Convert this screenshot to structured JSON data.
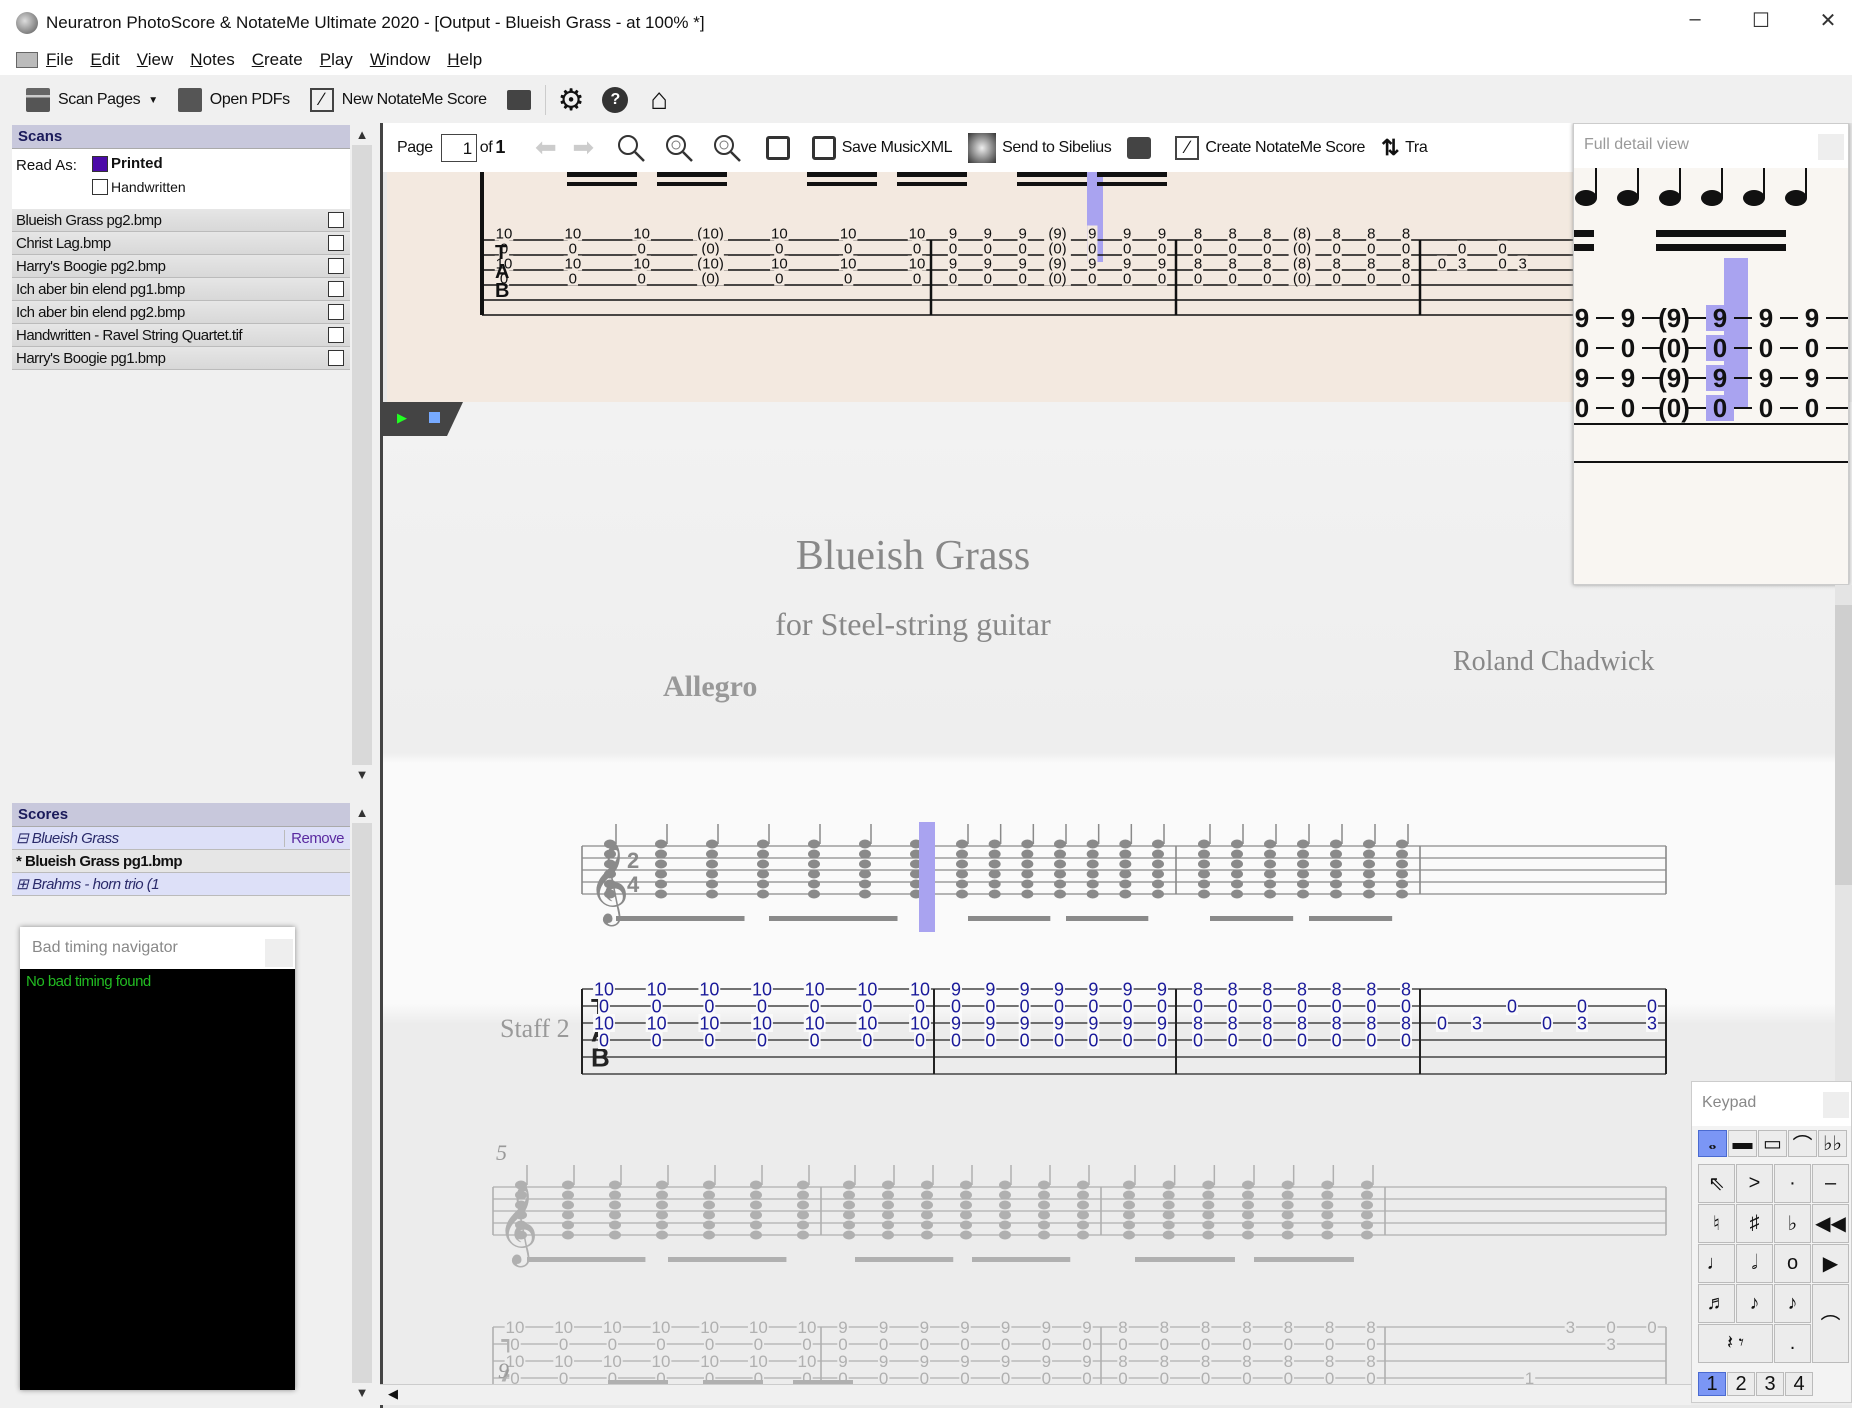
{
  "window": {
    "title": "Neuratron PhotoScore & NotateMe Ultimate 2020 - [Output - Blueish Grass - at 100% *]",
    "minimize": "–",
    "maximize": "☐",
    "close": "✕"
  },
  "menu": [
    "File",
    "Edit",
    "View",
    "Notes",
    "Create",
    "Play",
    "Window",
    "Help"
  ],
  "toolbar": {
    "scan_pages": "Scan Pages",
    "open_pdfs": "Open PDFs",
    "new_notateme": "New NotateMe Score"
  },
  "scans": {
    "header": "Scans",
    "read_as": "Read As:",
    "printed": "Printed",
    "handwritten": "Handwritten",
    "printed_checked": true,
    "files": [
      "Blueish Grass pg2.bmp",
      "Christ Lag.bmp",
      "Harry's Boogie pg2.bmp",
      "Ich aber bin elend pg1.bmp",
      "Ich aber bin elend pg2.bmp",
      "Handwritten - Ravel String Quartet.tif",
      "Harry's Boogie pg1.bmp"
    ]
  },
  "scores": {
    "header": "Scores",
    "items": [
      {
        "label": "Blueish Grass",
        "toggle": "⊟",
        "action": "Remove"
      },
      {
        "label": "* Blueish Grass pg1.bmp"
      },
      {
        "label": "Brahms - horn trio (1",
        "toggle": "⊞"
      }
    ]
  },
  "navigator": {
    "title": "Bad timing navigator",
    "message": "No bad timing found",
    "message_color": "#22bb22"
  },
  "doc_toolbar": {
    "page_label": "Page",
    "page_value": "1",
    "of_label": "of",
    "page_total": "1",
    "save_musicxml": "Save MusicXML",
    "send_sibelius": "Send to Sibelius",
    "create_notateme": "Create NotateMe Score",
    "transpose": "Tra"
  },
  "detail_view": {
    "title": "Full detail view",
    "tab_rows": [
      [
        "9",
        "9",
        "(9)",
        "9",
        "9",
        "9"
      ],
      [
        "0",
        "0",
        "(0)",
        "0",
        "0",
        "0"
      ],
      [
        "9",
        "9",
        "(9)",
        "9",
        "9",
        "9"
      ],
      [
        "0",
        "0",
        "(0)",
        "0",
        "0",
        "0"
      ]
    ]
  },
  "scan_tab": {
    "measures": [
      [
        [
          "10",
          "10",
          "10",
          "(10)",
          "10",
          "10",
          "10"
        ],
        [
          "0",
          "0",
          "0",
          "(0)",
          "0",
          "0",
          "0"
        ],
        [
          "10",
          "10",
          "10",
          "(10)",
          "10",
          "10",
          "10"
        ],
        [
          "0",
          "0",
          "0",
          "(0)",
          "0",
          "0",
          "0"
        ]
      ],
      [
        [
          "9",
          "9",
          "9",
          "(9)",
          "9",
          "9",
          "9"
        ],
        [
          "0",
          "0",
          "0",
          "(0)",
          "0",
          "0",
          "0"
        ],
        [
          "9",
          "9",
          "9",
          "(9)",
          "9",
          "9",
          "9"
        ],
        [
          "0",
          "0",
          "0",
          "(0)",
          "0",
          "0",
          "0"
        ]
      ],
      [
        [
          "8",
          "8",
          "8",
          "(8)",
          "8",
          "8",
          "8"
        ],
        [
          "0",
          "0",
          "0",
          "(0)",
          "0",
          "0",
          "0"
        ],
        [
          "8",
          "8",
          "8",
          "(8)",
          "8",
          "8",
          "8"
        ],
        [
          "0",
          "0",
          "0",
          "(0)",
          "0",
          "0",
          "0"
        ]
      ],
      [
        [],
        [
          "",
          "0",
          "",
          "0"
        ],
        [
          "0",
          "3",
          "",
          "0",
          "3"
        ],
        []
      ]
    ]
  },
  "score": {
    "title": "Blueish Grass",
    "subtitle": "for Steel-string guitar",
    "composer": "Roland Chadwick",
    "tempo": "Allegro",
    "staff_label": "Staff 2",
    "time_sig": [
      "2",
      "4"
    ],
    "tab_letters": [
      "T",
      "A",
      "B"
    ],
    "measure_numbers": [
      "5",
      "9"
    ],
    "tab_color": "#1a1a9a",
    "highlight_color": "#a9a3f0",
    "system1": [
      [
        [
          "10",
          "10",
          "10",
          "10",
          "10",
          "10",
          "10"
        ],
        [
          "0",
          "0",
          "0",
          "0",
          "0",
          "0",
          "0"
        ],
        [
          "10",
          "10",
          "10",
          "10",
          "10",
          "10",
          "10"
        ],
        [
          "0",
          "0",
          "0",
          "0",
          "0",
          "0",
          "0"
        ]
      ],
      [
        [
          "9",
          "9",
          "9",
          "9",
          "9",
          "9",
          "9"
        ],
        [
          "0",
          "0",
          "0",
          "0",
          "0",
          "0",
          "0"
        ],
        [
          "9",
          "9",
          "9",
          "9",
          "9",
          "9",
          "9"
        ],
        [
          "0",
          "0",
          "0",
          "0",
          "0",
          "0",
          "0"
        ]
      ],
      [
        [
          "8",
          "8",
          "8",
          "8",
          "8",
          "8",
          "8"
        ],
        [
          "0",
          "0",
          "0",
          "0",
          "0",
          "0",
          "0"
        ],
        [
          "8",
          "8",
          "8",
          "8",
          "8",
          "8",
          "8"
        ],
        [
          "0",
          "0",
          "0",
          "0",
          "0",
          "0",
          "0"
        ]
      ],
      [
        [],
        [
          "",
          "",
          "0",
          "",
          "0",
          "",
          "0"
        ],
        [
          "0",
          "3",
          "",
          "0",
          "3",
          "",
          "3"
        ],
        []
      ]
    ],
    "system2": [
      [
        [
          "10",
          "10",
          "10",
          "10",
          "10",
          "10",
          "10"
        ],
        [
          "0",
          "0",
          "0",
          "0",
          "0",
          "0",
          "0"
        ],
        [
          "10",
          "10",
          "10",
          "10",
          "10",
          "10",
          "10"
        ],
        [
          "0",
          "0",
          "0",
          "0",
          "0",
          "0",
          "0"
        ]
      ],
      [
        [
          "9",
          "9",
          "9",
          "9",
          "9",
          "9",
          "9"
        ],
        [
          "0",
          "0",
          "0",
          "0",
          "0",
          "0",
          "0"
        ],
        [
          "9",
          "9",
          "9",
          "9",
          "9",
          "9",
          "9"
        ],
        [
          "0",
          "0",
          "0",
          "0",
          "0",
          "0",
          "0"
        ]
      ],
      [
        [
          "8",
          "8",
          "8",
          "8",
          "8",
          "8",
          "8"
        ],
        [
          "0",
          "0",
          "0",
          "0",
          "0",
          "0",
          "0"
        ],
        [
          "8",
          "8",
          "8",
          "8",
          "8",
          "8",
          "8"
        ],
        [
          "0",
          "0",
          "0",
          "0",
          "0",
          "0",
          "0"
        ]
      ],
      [
        [
          "",
          "",
          "",
          "",
          "3",
          "0",
          "0"
        ],
        [
          "",
          "",
          "",
          "",
          "",
          "3",
          ""
        ],
        [],
        [
          "",
          "",
          "",
          "1",
          "",
          "",
          ""
        ]
      ]
    ]
  },
  "keypad": {
    "title": "Keypad",
    "tabs": [
      "𝅝",
      "▬",
      "▭",
      "⌒",
      "♭♭"
    ],
    "keys": [
      "⇖",
      ">",
      "·",
      "–",
      "♮",
      "♯",
      "♭",
      "◀◀",
      "♩",
      "𝅗𝅥",
      "o",
      "▶",
      "♬",
      "♪",
      "♪",
      "⌒",
      "𝄽 𝄾",
      "."
    ],
    "pages": [
      "1",
      "2",
      "3",
      "4"
    ],
    "active_page": "1"
  }
}
